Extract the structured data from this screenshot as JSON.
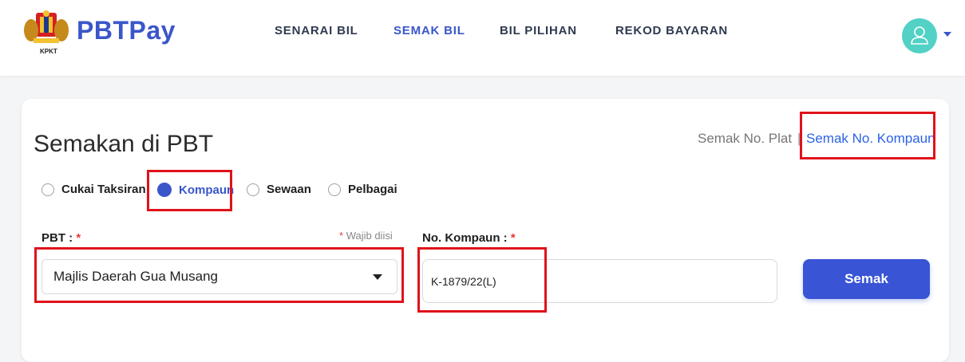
{
  "header": {
    "logo_caption": "KPKT",
    "brand": "PBTPay",
    "nav": [
      {
        "label": "SENARAI BIL",
        "active": false
      },
      {
        "label": "SEMAK BIL",
        "active": true
      },
      {
        "label": "BIL PILIHAN",
        "active": false
      },
      {
        "label": "REKOD BAYARAN",
        "active": false
      }
    ],
    "avatar_icon": "user-icon",
    "accent_color": "#3a56c9"
  },
  "card": {
    "title": "Semakan di PBT",
    "semak_plat": "Semak No. Plat",
    "separator": "|",
    "semak_kompaun": "Semak No. Kompaun",
    "radios": [
      {
        "label": "Cukai Taksiran",
        "selected": false
      },
      {
        "label": "Kompaun",
        "selected": true
      },
      {
        "label": "Sewaan",
        "selected": false
      },
      {
        "label": "Pelbagai",
        "selected": false
      }
    ],
    "pbt_label": "PBT :",
    "required_mark": "*",
    "wajib_note": "Wajib diisi",
    "pbt_value": "Majlis Daerah Gua Musang",
    "kompaun_label": "No. Kompaun :",
    "kompaun_value": "K-1879/22(L)",
    "submit_label": "Semak"
  }
}
